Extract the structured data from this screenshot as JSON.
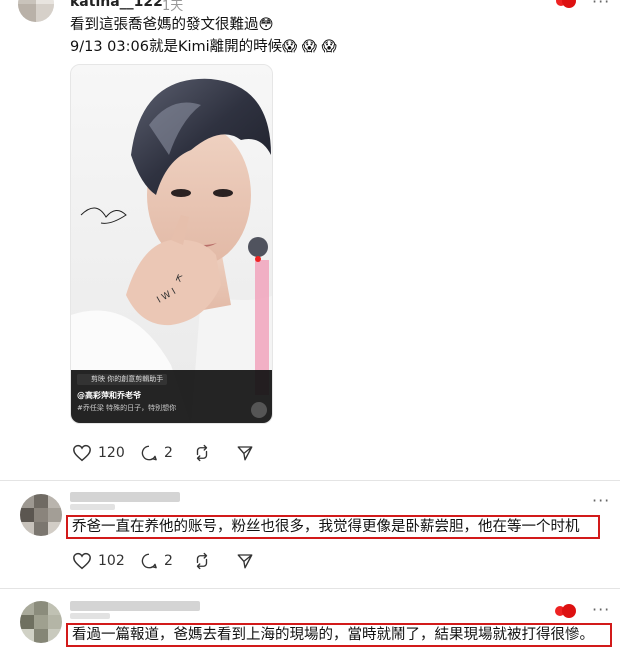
{
  "post": {
    "username": "katina__122",
    "time": "1天",
    "text_line1": "看到這張喬爸媽的發文很難過😳",
    "text_line2": "9/13 03:06就是Kimi離開的時候😱 😱 😱",
    "image": {
      "watermark_app": "剪映",
      "watermark_slogan": "你的創意剪輯助手",
      "handle": "@高彩萍和乔老爷",
      "caption": "#乔任梁 特殊的日子，特别想你",
      "ring_letters": "KIMI"
    },
    "likes": "120",
    "replies": "2"
  },
  "comment1": {
    "text": "乔爸一直在养他的账号，粉丝也很多，我觉得更像是卧薪尝胆，他在等一个时机",
    "likes": "102",
    "replies": "2"
  },
  "comment2": {
    "text": "看過一篇報道，爸媽去看到上海的現場的，當時就鬧了，結果現場就被打得很慘。"
  },
  "colors": {
    "highlight": "#d21a1a",
    "divider": "#e4e4e4",
    "muted": "#999999"
  },
  "icons": [
    "heart-icon",
    "reply-icon",
    "repost-icon",
    "share-icon",
    "more-icon"
  ]
}
